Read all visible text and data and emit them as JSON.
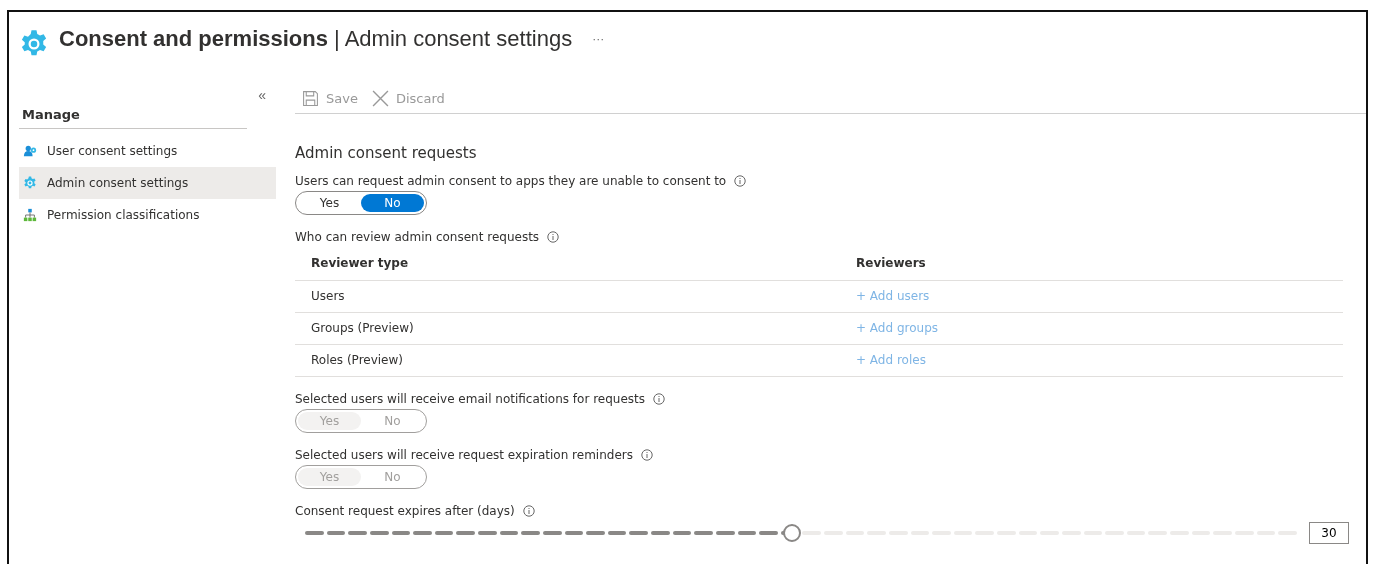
{
  "header": {
    "title": "Consent and permissions",
    "separator": "|",
    "subtitle": "Admin consent settings",
    "more": "···"
  },
  "sidebar": {
    "collapse": "«",
    "section": "Manage",
    "items": [
      {
        "label": "User consent settings",
        "selected": false
      },
      {
        "label": "Admin consent settings",
        "selected": true
      },
      {
        "label": "Permission classifications",
        "selected": false
      }
    ]
  },
  "toolbar": [
    {
      "label": "Save",
      "kind": "save",
      "disabled": true
    },
    {
      "label": "Discard",
      "kind": "discard",
      "disabled": true
    }
  ],
  "section_title": "Admin consent requests",
  "settings": [
    {
      "kind": "toggle",
      "label": "Users can request admin consent to apps they are unable to consent to",
      "options": [
        {
          "label": "Yes",
          "selected": false
        },
        {
          "label": "No",
          "selected": true
        }
      ],
      "disabled": false
    },
    {
      "kind": "table",
      "label": "Who can review admin consent requests",
      "columns": [
        "Reviewer type",
        "Reviewers"
      ],
      "rows": [
        [
          "Users",
          "+ Add users"
        ],
        [
          "Groups (Preview)",
          "+ Add groups"
        ],
        [
          "Roles (Preview)",
          "+ Add roles"
        ]
      ]
    },
    {
      "kind": "toggle",
      "label": "Selected users will receive email notifications for requests",
      "options": [
        {
          "label": "Yes",
          "selected": true
        },
        {
          "label": "No",
          "selected": false
        }
      ],
      "disabled": true
    },
    {
      "kind": "toggle",
      "label": "Selected users will receive request expiration reminders",
      "options": [
        {
          "label": "Yes",
          "selected": true
        },
        {
          "label": "No",
          "selected": false
        }
      ],
      "disabled": true
    },
    {
      "kind": "slider",
      "label": "Consent request expires after (days)",
      "level": 0.49,
      "value": "30"
    }
  ]
}
